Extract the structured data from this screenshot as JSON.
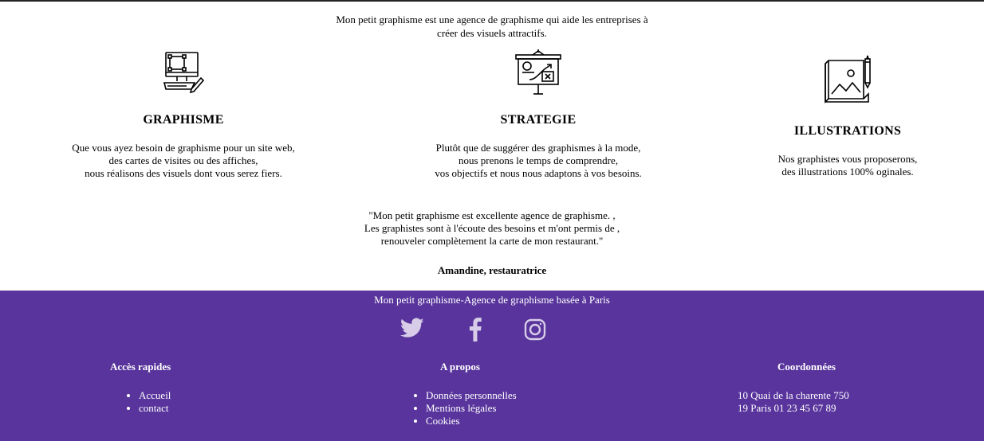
{
  "intro": {
    "line1": "Mon petit graphisme est une agence de graphisme qui aide les entreprises à",
    "line2": "créer des visuels attractifs."
  },
  "services": [
    {
      "title": "GRAPHISME",
      "icon": "computer-design-icon",
      "lines": [
        "Que vous ayez besoin de graphisme pour un site web,",
        "des cartes de visites ou des affiches,",
        "nous réalisons des visuels dont vous serez fiers."
      ]
    },
    {
      "title": "STRATEGIE",
      "icon": "strategy-board-icon",
      "lines": [
        "Plutôt que de suggérer des graphismes à la mode,",
        "nous prenons le temps de comprendre,",
        "vos objectifs et nous nous adaptons à vos besoins."
      ]
    },
    {
      "title": "ILLUSTRATIONS",
      "icon": "illustration-pencil-icon",
      "lines": [
        "Nos graphistes vous proposerons,",
        "des illustrations 100% oginales."
      ]
    }
  ],
  "testimonial": {
    "lines": [
      "\"Mon petit graphisme est excellente agence de graphisme. ,",
      "Les graphistes sont à l'écoute des besoins et m'ont permis de ,",
      "renouveler complètement la carte de mon restaurant.\""
    ],
    "author": "Amandine, restauratrice"
  },
  "footer": {
    "tagline": "Mon petit graphisme-Agence de graphisme basée à Paris",
    "social_icons": [
      "twitter-icon",
      "facebook-icon",
      "instagram-icon"
    ],
    "columns": [
      {
        "title": "Accès rapides",
        "links": [
          "Accueil",
          "contact"
        ]
      },
      {
        "title": "A propos",
        "links": [
          "Données personnelles",
          "Mentions légales",
          "Cookies"
        ]
      },
      {
        "title": "Coordonnées",
        "address": [
          "10 Quai de la charente 750",
          "19 Paris 01 23 45 67 89"
        ]
      }
    ],
    "colors": {
      "background": "#58349c",
      "icon": "#d8cde8"
    }
  }
}
